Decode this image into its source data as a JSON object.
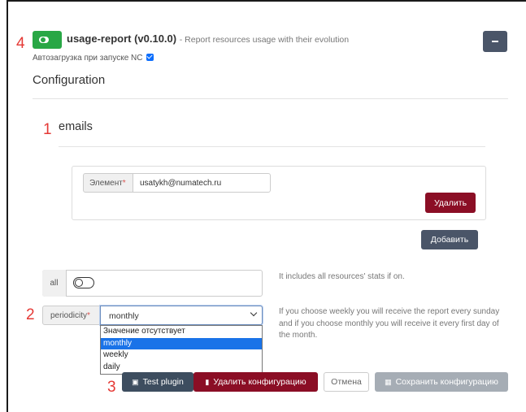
{
  "markers": {
    "m1": "1",
    "m2": "2",
    "m3": "3",
    "m4": "4"
  },
  "plugin": {
    "name": "usage-report (v0.10.0)",
    "description": "- Report resources usage with their evolution",
    "autoload": "Автозагрузка при запуске NC",
    "autoload_checked": true,
    "enabled": true
  },
  "config": {
    "title": "Configuration",
    "emails": {
      "title": "emails",
      "element_label": "Элемент",
      "element_value": "usatykh@numatech.ru",
      "delete_label": "Удалить",
      "add_label": "Добавить"
    },
    "all": {
      "label": "all",
      "help": "It includes all resources' stats if on.",
      "on": false
    },
    "periodicity": {
      "label": "periodicity",
      "value": "monthly",
      "help": "If you choose weekly you will receive the report every sunday and if you choose monthly you will receive it every first day of the month.",
      "options": [
        "Значение отсутствует",
        "monthly",
        "weekly",
        "daily"
      ],
      "selected_index": 1
    }
  },
  "actions": {
    "test": "Test plugin",
    "delete_config": "Удалить конфигурацию",
    "cancel": "Отмена",
    "save": "Сохранить конфигурацию"
  },
  "colors": {
    "success": "#28a745",
    "danger": "#8b0e25",
    "secondary": "#4a5568",
    "disabled": "#a6adb5",
    "marker": "#e53935"
  }
}
